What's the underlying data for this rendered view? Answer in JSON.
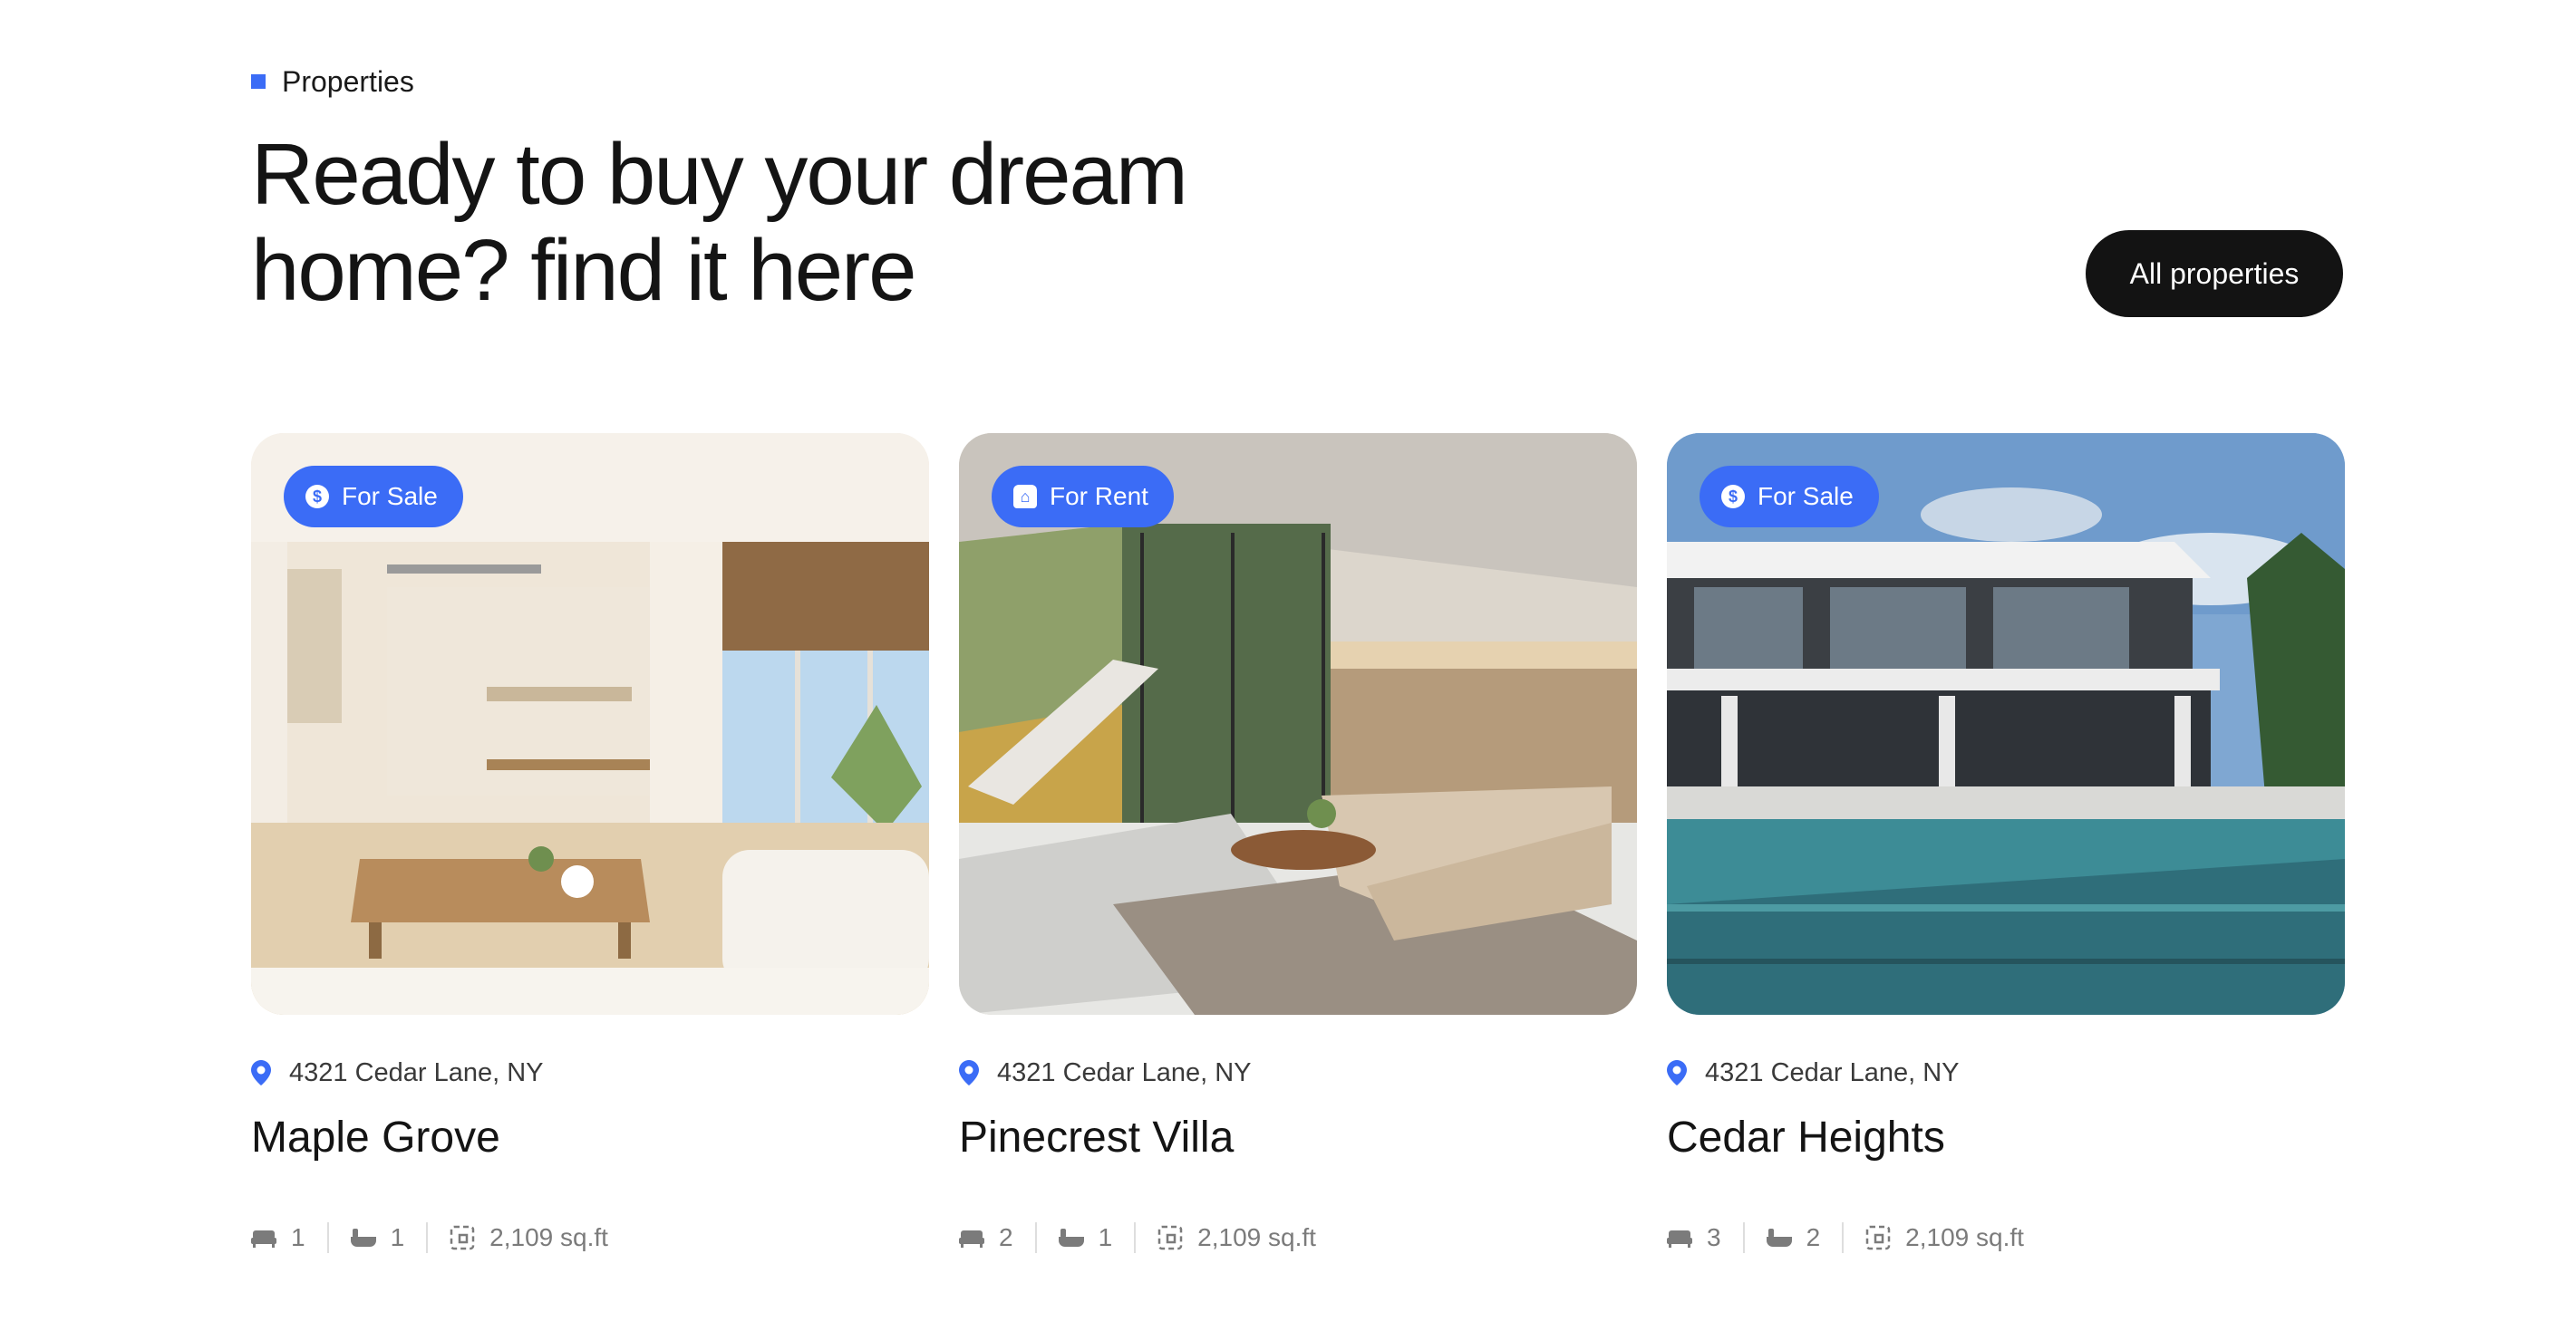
{
  "section": {
    "eyebrow": "Properties",
    "headline_line1": "Ready to buy your dream",
    "headline_line2": "home? find it here",
    "all_button": "All properties",
    "accent_color": "#3b6cf6"
  },
  "cards": [
    {
      "badge": "For Sale",
      "badge_icon": "dollar-circle-icon",
      "address": "4321 Cedar Lane, NY",
      "name": "Maple Grove",
      "beds": "1",
      "baths": "1",
      "area": "2,109 sq.ft",
      "image": "bright-interior-living-dining-room"
    },
    {
      "badge": "For Rent",
      "badge_icon": "house-icon",
      "address": "4321 Cedar Lane, NY",
      "name": "Pinecrest Villa",
      "beds": "2",
      "baths": "1",
      "area": "2,109 sq.ft",
      "image": "modern-living-room-with-staircase"
    },
    {
      "badge": "For Sale",
      "badge_icon": "dollar-circle-icon",
      "address": "4321 Cedar Lane, NY",
      "name": "Cedar Heights",
      "beds": "3",
      "baths": "2",
      "area": "2,109 sq.ft",
      "image": "modern-villa-with-pool"
    }
  ]
}
